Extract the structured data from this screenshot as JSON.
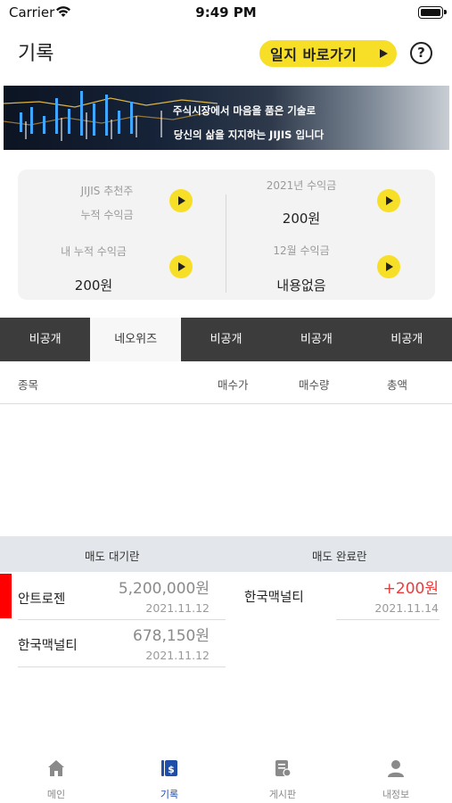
{
  "status_bar": {
    "carrier": "Carrier",
    "time": "9:49 PM"
  },
  "header": {
    "title": "기록",
    "diary_button": "일지 바로가기",
    "help": "?"
  },
  "banner": {
    "line1": "주식시장에서 마음을 품은 기술로",
    "line2": "당신의 삶을 지지하는 JIJIS 입니다"
  },
  "summary": {
    "left": {
      "recommend_label": "JIJIS 추천주",
      "cumulative_label": "누적 수익금",
      "my_cumulative_label": "내 누적 수익금",
      "my_cumulative_value": "200원"
    },
    "right": {
      "year_label": "2021년 수익금",
      "year_value": "200원",
      "month_label": "12월 수익금",
      "month_value": "내용없음"
    }
  },
  "tabs": [
    {
      "label": "비공개",
      "active": false
    },
    {
      "label": "네오위즈",
      "active": true
    },
    {
      "label": "비공개",
      "active": false
    },
    {
      "label": "비공개",
      "active": false
    },
    {
      "label": "비공개",
      "active": false
    }
  ],
  "table": {
    "col_name": "종목",
    "col_buy_price": "매수가",
    "col_buy_qty": "매수량",
    "col_total": "총액"
  },
  "sell": {
    "pending_title": "매도 대기란",
    "done_title": "매도 완료란",
    "pending": [
      {
        "name": "안트로젠",
        "amount": "5,200,000원",
        "date": "2021.11.12"
      },
      {
        "name": "한국맥널티",
        "amount": "678,150원",
        "date": "2021.11.12"
      }
    ],
    "done": [
      {
        "name": "한국맥널티",
        "amount": "+200원",
        "date": "2021.11.14"
      }
    ]
  },
  "nav": [
    {
      "label": "메인",
      "icon": "home-icon",
      "active": false
    },
    {
      "label": "기록",
      "icon": "record-icon",
      "active": true
    },
    {
      "label": "게시판",
      "icon": "board-icon",
      "active": false
    },
    {
      "label": "내정보",
      "icon": "user-icon",
      "active": false
    }
  ],
  "colors": {
    "accent_yellow": "#f8df27",
    "tab_dark": "#3c3c3c",
    "profit_red": "#ee3a3a",
    "nav_active": "#1e4ea8"
  }
}
